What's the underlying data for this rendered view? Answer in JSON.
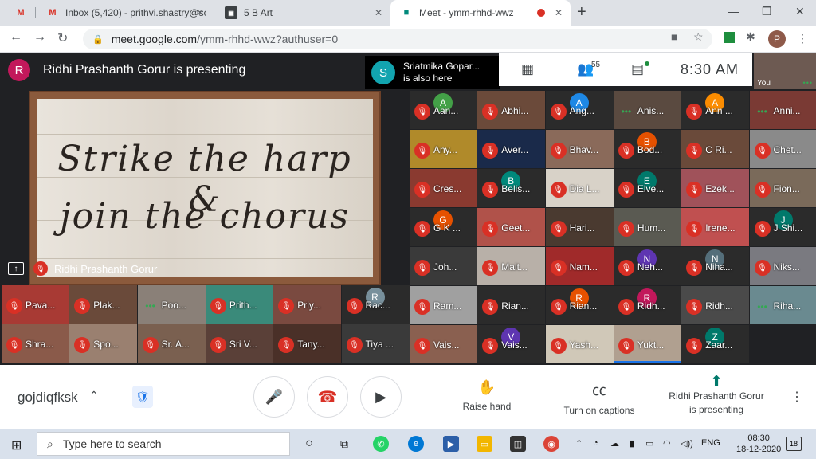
{
  "browser": {
    "tabs": [
      {
        "label": "",
        "icon": "gmail-icon"
      },
      {
        "label": "Inbox (5,420) - prithvi.shastry@sc",
        "icon": "gmail-icon"
      },
      {
        "label": "5 B Art",
        "icon": "classroom-icon"
      },
      {
        "label": "Meet - ymm-rhhd-wwz",
        "icon": "meet-icon"
      }
    ],
    "url_host": "meet.google.com",
    "url_path": "/ymm-rhhd-wwz?authuser=0",
    "profile_initial": "P"
  },
  "meet": {
    "presenter_initial": "R",
    "presenter_banner": "Ridhi Prashanth Gorur is presenting",
    "also_here_initial": "S",
    "also_here_name": "Sriatmika Gopar...",
    "also_here_status": "is also here",
    "participant_count": "55",
    "clock": "8:30  AM",
    "self_label": "You",
    "slide_line1": "Strike the harp &",
    "slide_line2": "join the chorus",
    "presentation_label": "Ridhi Prashanth Gorur",
    "tiles": [
      {
        "name": "Aan...",
        "av": "A",
        "avc": "#43a047",
        "bg": "#2b2b2b"
      },
      {
        "name": "Abhi...",
        "bg": "#6b4a3a"
      },
      {
        "name": "Ang...",
        "av": "A",
        "avc": "#1e88e5",
        "bg": "#2b2b2b"
      },
      {
        "name": "Anis...",
        "bg": "#5a4a40",
        "talk": true
      },
      {
        "name": "Ann ...",
        "av": "A",
        "avc": "#fb8c00",
        "bg": "#2b2b2b"
      },
      {
        "name": "Anni...",
        "bg": "#7a3a34",
        "talk": true
      },
      {
        "name": "Any...",
        "bg": "#b08a2a"
      },
      {
        "name": "Aver...",
        "bg": "#1a2a4a"
      },
      {
        "name": "Bhav...",
        "bg": "#8a6a5a"
      },
      {
        "name": "Bod...",
        "av": "B",
        "avc": "#e65100",
        "bg": "#2b2b2b"
      },
      {
        "name": "C Ri...",
        "bg": "#6a4a3a"
      },
      {
        "name": "Chet...",
        "bg": "#8a8a8a"
      },
      {
        "name": "Cres...",
        "bg": "#8a3a30"
      },
      {
        "name": "Belis...",
        "av": "B",
        "avc": "#00897b",
        "bg": "#2b2b2b"
      },
      {
        "name": "Dia L...",
        "bg": "#d8d2c8"
      },
      {
        "name": "Elve...",
        "av": "E",
        "avc": "#00796b",
        "bg": "#2b2b2b"
      },
      {
        "name": "Ezek...",
        "bg": "#a0525a"
      },
      {
        "name": "Fion...",
        "bg": "#7a6a5a"
      },
      {
        "name": "G K ...",
        "av": "G",
        "avc": "#e65100",
        "bg": "#2b2b2b"
      },
      {
        "name": "Geet...",
        "bg": "#b0524a"
      },
      {
        "name": "Hari...",
        "bg": "#4a3a30"
      },
      {
        "name": "Hum...",
        "bg": "#5a5a52"
      },
      {
        "name": "Irene...",
        "bg": "#c05050"
      },
      {
        "name": "J Shi...",
        "av": "J",
        "avc": "#00796b",
        "bg": "#2b2b2b"
      },
      {
        "name": "Joh...",
        "bg": "#3a3a3a"
      },
      {
        "name": "Mait...",
        "bg": "#b8b0a8"
      },
      {
        "name": "Nam...",
        "bg": "#a02a2a"
      },
      {
        "name": "Neh...",
        "av": "N",
        "avc": "#5e35b1",
        "bg": "#2b2b2b"
      },
      {
        "name": "Niha...",
        "av": "N",
        "avc": "#546e7a",
        "bg": "#2b2b2b"
      },
      {
        "name": "Niks...",
        "bg": "#7a7a80"
      },
      {
        "name": "Ram...",
        "bg": "#a0a0a0"
      },
      {
        "name": "Rian...",
        "bg": "#2b2b2b"
      },
      {
        "name": "Rian...",
        "av": "R",
        "avc": "#e65100",
        "bg": "#2b2b2b"
      },
      {
        "name": "Ridh...",
        "av": "R",
        "avc": "#c2185b",
        "bg": "#2b2b2b"
      },
      {
        "name": "Ridh...",
        "bg": "#4a4a4a"
      },
      {
        "name": "Riha...",
        "bg": "#6a8a90",
        "talk": true
      },
      {
        "name": "Vais...",
        "bg": "#8a6050"
      },
      {
        "name": "Vais...",
        "av": "V",
        "avc": "#5e35b1",
        "bg": "#2b2b2b"
      },
      {
        "name": "Yash...",
        "bg": "#d0c8b8"
      },
      {
        "name": "Yukt...",
        "bg": "#b0a090",
        "speaking": true
      },
      {
        "name": "Zaar...",
        "av": "Z",
        "avc": "#00796b",
        "bg": "#2b2b2b"
      },
      {
        "name": "",
        "bg": "#202124"
      },
      {
        "name": "Pava...",
        "bg": "#a83a34"
      },
      {
        "name": "Plak...",
        "bg": "#6a4a3a"
      },
      {
        "name": "Poo...",
        "bg": "#8a8078",
        "talk": true
      },
      {
        "name": "Prith...",
        "bg": "#3a8a7a"
      },
      {
        "name": "Priy...",
        "bg": "#7a4a40"
      },
      {
        "name": "Rac...",
        "av": "R",
        "avc": "#78909c",
        "bg": "#2b2b2b"
      },
      {
        "name": "Shra...",
        "bg": "#8a5a4a"
      },
      {
        "name": "Spo...",
        "bg": "#9a8070"
      },
      {
        "name": "Sr. A...",
        "bg": "#7a6050"
      },
      {
        "name": "Sri V...",
        "bg": "#5a4038"
      },
      {
        "name": "Tany...",
        "bg": "#4a3028"
      },
      {
        "name": "Tiya ...",
        "bg": "#3a3a3a"
      }
    ]
  },
  "controls": {
    "meeting_code": "gojdiqfksk",
    "raise_hand": "Raise hand",
    "captions": "Turn on captions",
    "presenting_line1": "Ridhi Prashanth Gorur",
    "presenting_line2": "is presenting"
  },
  "taskbar": {
    "search_placeholder": "Type here to search",
    "lang": "ENG",
    "time": "08:30",
    "date": "18-12-2020",
    "notifications": "18"
  }
}
